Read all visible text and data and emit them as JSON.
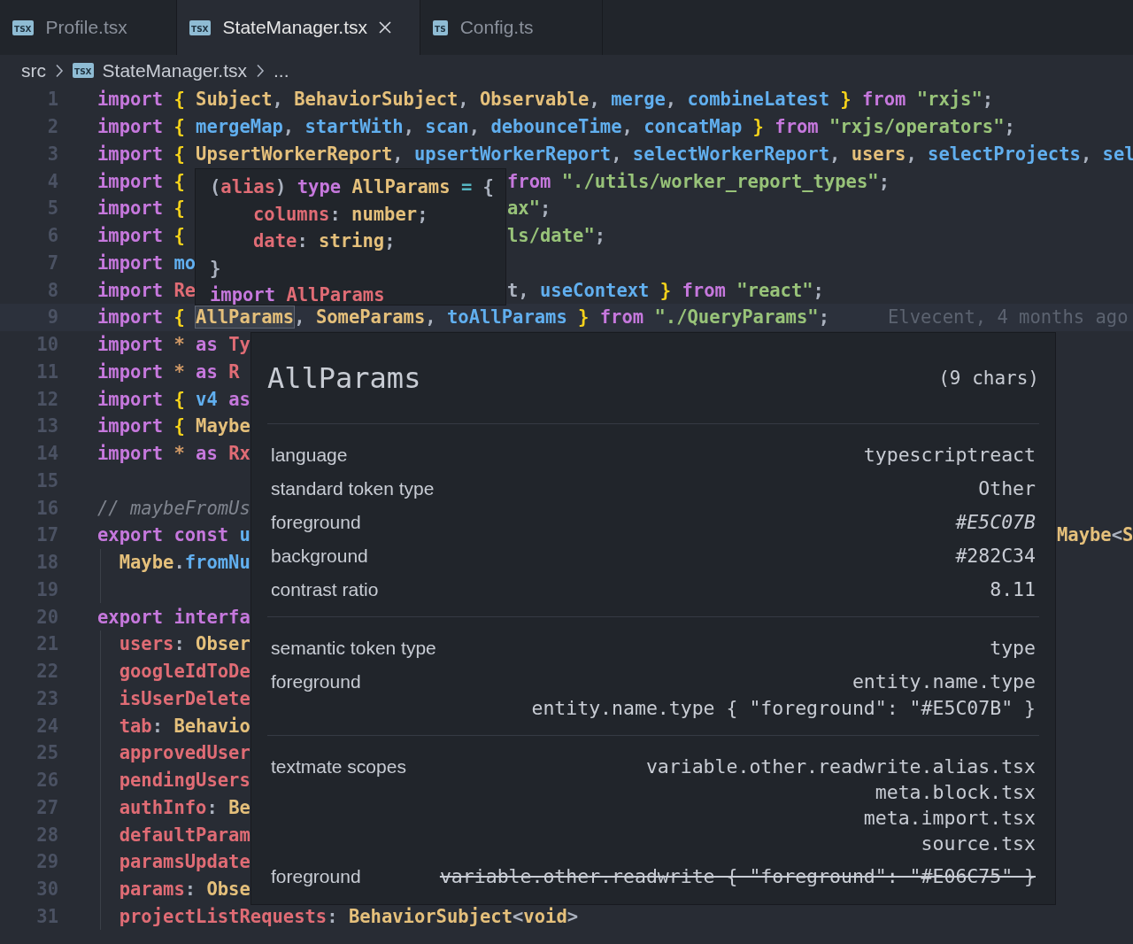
{
  "tabs": [
    {
      "badge": "TSX",
      "label": "Profile.tsx",
      "selected": false
    },
    {
      "badge": "TSX",
      "label": "StateManager.tsx",
      "selected": true
    },
    {
      "badge": "TS",
      "label": "Config.ts",
      "selected": false
    }
  ],
  "breadcrumb": [
    {
      "text": "src"
    },
    {
      "badge": "TSX",
      "text": "StateManager.tsx"
    },
    {
      "text": "..."
    }
  ],
  "lines": [
    {
      "num": "1",
      "current": false,
      "indented": false,
      "code": [
        {
          "kind": "kw",
          "text": "import "
        },
        {
          "kind": "br",
          "text": "{ "
        },
        {
          "kind": "ty",
          "text": "Subject"
        },
        {
          "kind": "pl",
          "text": ", "
        },
        {
          "kind": "ty",
          "text": "BehaviorSubject"
        },
        {
          "kind": "pl",
          "text": ", "
        },
        {
          "kind": "ty",
          "text": "Observable"
        },
        {
          "kind": "pl",
          "text": ", "
        },
        {
          "kind": "fn",
          "text": "merge"
        },
        {
          "kind": "pl",
          "text": ", "
        },
        {
          "kind": "fn",
          "text": "combineLatest"
        },
        {
          "kind": "br",
          "text": " }"
        },
        {
          "kind": "kw",
          "text": " from "
        },
        {
          "kind": "str",
          "text": "\"rxjs\""
        },
        {
          "kind": "pl",
          "text": ";"
        }
      ]
    },
    {
      "num": "2",
      "current": false,
      "indented": false,
      "code": [
        {
          "kind": "kw",
          "text": "import "
        },
        {
          "kind": "br",
          "text": "{ "
        },
        {
          "kind": "fn",
          "text": "mergeMap"
        },
        {
          "kind": "pl",
          "text": ", "
        },
        {
          "kind": "fn",
          "text": "startWith"
        },
        {
          "kind": "pl",
          "text": ", "
        },
        {
          "kind": "fn",
          "text": "scan"
        },
        {
          "kind": "pl",
          "text": ", "
        },
        {
          "kind": "fn",
          "text": "debounceTime"
        },
        {
          "kind": "pl",
          "text": ", "
        },
        {
          "kind": "fn",
          "text": "concatMap"
        },
        {
          "kind": "br",
          "text": " }"
        },
        {
          "kind": "kw",
          "text": " from "
        },
        {
          "kind": "str",
          "text": "\"rxjs/operators\""
        },
        {
          "kind": "pl",
          "text": ";"
        }
      ]
    },
    {
      "num": "3",
      "current": false,
      "indented": false,
      "code": [
        {
          "kind": "kw",
          "text": "import "
        },
        {
          "kind": "br",
          "text": "{ "
        },
        {
          "kind": "ty",
          "text": "UpsertWorkerReport"
        },
        {
          "kind": "pl",
          "text": ", "
        },
        {
          "kind": "fn",
          "text": "upsertWorkerReport"
        },
        {
          "kind": "pl",
          "text": ", "
        },
        {
          "kind": "fn",
          "text": "selectWorkerReport"
        },
        {
          "kind": "pl",
          "text": ", "
        },
        {
          "kind": "ty",
          "text": "users"
        },
        {
          "kind": "pl",
          "text": ", "
        },
        {
          "kind": "fn",
          "text": "selectProjects"
        },
        {
          "kind": "pl",
          "text": ", "
        },
        {
          "kind": "fn",
          "text": "sel"
        }
      ]
    },
    {
      "num": "4",
      "current": false,
      "indented": false,
      "code": [
        {
          "kind": "kw",
          "text": "import "
        },
        {
          "kind": "br",
          "text": "{"
        }
      ],
      "tail": [
        {
          "kind": "kw",
          "text": "from "
        },
        {
          "kind": "str",
          "text": "\"./utils/worker_report_types\""
        },
        {
          "kind": "pl",
          "text": ";"
        }
      ]
    },
    {
      "num": "5",
      "current": false,
      "indented": false,
      "code": [
        {
          "kind": "kw",
          "text": "import "
        },
        {
          "kind": "br",
          "text": "{"
        }
      ],
      "tail": [
        {
          "kind": "str",
          "text": "ax\""
        },
        {
          "kind": "pl",
          "text": ";"
        }
      ]
    },
    {
      "num": "6",
      "current": false,
      "indented": false,
      "code": [
        {
          "kind": "kw",
          "text": "import "
        },
        {
          "kind": "br",
          "text": "{"
        }
      ],
      "tail": [
        {
          "kind": "str",
          "text": "ls/date\""
        },
        {
          "kind": "pl",
          "text": ";"
        }
      ]
    },
    {
      "num": "7",
      "current": false,
      "indented": false,
      "code": [
        {
          "kind": "kw",
          "text": "import "
        },
        {
          "kind": "fn",
          "text": "mo"
        }
      ]
    },
    {
      "num": "8",
      "current": false,
      "indented": false,
      "code": [
        {
          "kind": "kw",
          "text": "import "
        },
        {
          "kind": "var",
          "text": "Re"
        }
      ],
      "tail": [
        {
          "kind": "pl",
          "text": "t, "
        },
        {
          "kind": "fn",
          "text": "useContext"
        },
        {
          "kind": "br",
          "text": " }"
        },
        {
          "kind": "kw",
          "text": " from "
        },
        {
          "kind": "str",
          "text": "\"react\""
        },
        {
          "kind": "pl",
          "text": ";"
        }
      ]
    },
    {
      "num": "9",
      "current": true,
      "indented": false,
      "code": [
        {
          "kind": "kw",
          "text": "import "
        },
        {
          "kind": "br",
          "text": "{ "
        },
        {
          "kind": "match",
          "text": "AllParams"
        },
        {
          "kind": "pl",
          "text": ", "
        },
        {
          "kind": "ty",
          "text": "SomeParams"
        },
        {
          "kind": "pl",
          "text": ", "
        },
        {
          "kind": "fn",
          "text": "toAllParams"
        },
        {
          "kind": "br",
          "text": " }"
        },
        {
          "kind": "kw",
          "text": " from "
        },
        {
          "kind": "str",
          "text": "\"./QueryParams\""
        },
        {
          "kind": "pl",
          "text": ";"
        }
      ],
      "blame": "Elvecent, 4 months ago"
    },
    {
      "num": "10",
      "current": false,
      "indented": false,
      "code": [
        {
          "kind": "kw",
          "text": "import "
        },
        {
          "kind": "op",
          "text": "* "
        },
        {
          "kind": "kw",
          "text": "as "
        },
        {
          "kind": "var",
          "text": "Ty"
        }
      ]
    },
    {
      "num": "11",
      "current": false,
      "indented": false,
      "code": [
        {
          "kind": "kw",
          "text": "import "
        },
        {
          "kind": "op",
          "text": "* "
        },
        {
          "kind": "kw",
          "text": "as "
        },
        {
          "kind": "var",
          "text": "R"
        }
      ]
    },
    {
      "num": "12",
      "current": false,
      "indented": false,
      "code": [
        {
          "kind": "kw",
          "text": "import "
        },
        {
          "kind": "br",
          "text": "{ "
        },
        {
          "kind": "fn",
          "text": "v4 "
        },
        {
          "kind": "kw",
          "text": "as"
        }
      ]
    },
    {
      "num": "13",
      "current": false,
      "indented": false,
      "code": [
        {
          "kind": "kw",
          "text": "import "
        },
        {
          "kind": "br",
          "text": "{ "
        },
        {
          "kind": "ty",
          "text": "Maybe"
        }
      ]
    },
    {
      "num": "14",
      "current": false,
      "indented": false,
      "code": [
        {
          "kind": "kw",
          "text": "import "
        },
        {
          "kind": "op",
          "text": "* "
        },
        {
          "kind": "kw",
          "text": "as "
        },
        {
          "kind": "var",
          "text": "Rx"
        }
      ]
    },
    {
      "num": "15",
      "current": false,
      "indented": false
    },
    {
      "num": "16",
      "current": false,
      "indented": false,
      "code": [
        {
          "kind": "cm",
          "text": "// maybeFromUs"
        }
      ]
    },
    {
      "num": "17",
      "current": false,
      "indented": false,
      "code": [
        {
          "kind": "kw",
          "text": "export const "
        },
        {
          "kind": "fn",
          "text": "u"
        }
      ],
      "tail": [
        {
          "kind": "ty",
          "text": "Maybe"
        },
        {
          "kind": "pl",
          "text": "<"
        },
        {
          "kind": "ty",
          "text": "S"
        }
      ]
    },
    {
      "num": "18",
      "current": false,
      "indented": true,
      "code": [
        {
          "kind": "ty",
          "text": "Maybe"
        },
        {
          "kind": "pl",
          "text": "."
        },
        {
          "kind": "fn",
          "text": "fromNu"
        }
      ]
    },
    {
      "num": "19",
      "current": false,
      "indented": true
    },
    {
      "num": "20",
      "current": false,
      "indented": false,
      "code": [
        {
          "kind": "kw",
          "text": "export interfa"
        }
      ]
    },
    {
      "num": "21",
      "current": false,
      "indented": true,
      "code": [
        {
          "kind": "var",
          "text": "users"
        },
        {
          "kind": "pl",
          "text": ": "
        },
        {
          "kind": "ty",
          "text": "Obser"
        }
      ]
    },
    {
      "num": "22",
      "current": false,
      "indented": true,
      "code": [
        {
          "kind": "var",
          "text": "googleIdToDe"
        }
      ]
    },
    {
      "num": "23",
      "current": false,
      "indented": true,
      "code": [
        {
          "kind": "var",
          "text": "isUserDelete"
        }
      ]
    },
    {
      "num": "24",
      "current": false,
      "indented": true,
      "code": [
        {
          "kind": "var",
          "text": "tab"
        },
        {
          "kind": "pl",
          "text": ": "
        },
        {
          "kind": "ty",
          "text": "Behavio"
        }
      ]
    },
    {
      "num": "25",
      "current": false,
      "indented": true,
      "code": [
        {
          "kind": "var",
          "text": "approvedUser"
        }
      ]
    },
    {
      "num": "26",
      "current": false,
      "indented": true,
      "code": [
        {
          "kind": "var",
          "text": "pendingUsers"
        }
      ]
    },
    {
      "num": "27",
      "current": false,
      "indented": true,
      "code": [
        {
          "kind": "var",
          "text": "authInfo"
        },
        {
          "kind": "pl",
          "text": ": "
        },
        {
          "kind": "ty",
          "text": "Be"
        }
      ]
    },
    {
      "num": "28",
      "current": false,
      "indented": true,
      "code": [
        {
          "kind": "var",
          "text": "defaultParam"
        }
      ]
    },
    {
      "num": "29",
      "current": false,
      "indented": true,
      "code": [
        {
          "kind": "var",
          "text": "paramsUpdate"
        }
      ]
    },
    {
      "num": "30",
      "current": false,
      "indented": true,
      "code": [
        {
          "kind": "var",
          "text": "params"
        },
        {
          "kind": "pl",
          "text": ": "
        },
        {
          "kind": "ty",
          "text": "Obse"
        }
      ]
    },
    {
      "num": "31",
      "current": false,
      "indented": true,
      "code": [
        {
          "kind": "var",
          "text": "projectListRequests"
        },
        {
          "kind": "pl",
          "text": ": "
        },
        {
          "kind": "ty",
          "text": "BehaviorSubject"
        },
        {
          "kind": "pl",
          "text": "<"
        },
        {
          "kind": "ty",
          "text": "void"
        },
        {
          "kind": "pl",
          "text": ">"
        }
      ]
    }
  ],
  "type_hover": {
    "lines": [
      {
        "indented": false,
        "code": [
          {
            "kind": "pl",
            "text": "("
          },
          {
            "kind": "var",
            "text": "alias"
          },
          {
            "kind": "pl",
            "text": ") "
          },
          {
            "kind": "kw",
            "text": "type "
          },
          {
            "kind": "ty",
            "text": "AllParams"
          },
          {
            "kind": "cy",
            "text": " = "
          },
          {
            "kind": "pl",
            "text": "{"
          }
        ]
      },
      {
        "indented": true,
        "code": [
          {
            "kind": "var",
            "text": "columns"
          },
          {
            "kind": "pl",
            "text": ": "
          },
          {
            "kind": "ty",
            "text": "number"
          },
          {
            "kind": "pl",
            "text": ";"
          }
        ]
      },
      {
        "indented": true,
        "code": [
          {
            "kind": "var",
            "text": "date"
          },
          {
            "kind": "pl",
            "text": ": "
          },
          {
            "kind": "ty",
            "text": "string"
          },
          {
            "kind": "pl",
            "text": ";"
          }
        ]
      },
      {
        "indented": false,
        "code": [
          {
            "kind": "pl",
            "text": "}"
          }
        ]
      },
      {
        "indented": false,
        "code": [
          {
            "kind": "kw",
            "text": "import "
          },
          {
            "kind": "var",
            "text": "AllParams"
          }
        ]
      }
    ]
  },
  "inspector": {
    "title": "AllParams",
    "length": "(9 chars)",
    "sections": [
      {
        "rows": [
          {
            "kind": "text",
            "label": "language",
            "values": [
              "typescriptreact"
            ]
          },
          {
            "kind": "text",
            "label": "standard token type",
            "values": [
              "Other"
            ]
          },
          {
            "kind": "color",
            "label": "foreground",
            "values": [
              "#E5C07B"
            ]
          },
          {
            "kind": "text",
            "label": "background",
            "values": [
              "#282C34"
            ]
          },
          {
            "kind": "text",
            "label": "contrast ratio",
            "values": [
              "8.11"
            ]
          }
        ]
      },
      {
        "rows": [
          {
            "kind": "text",
            "label": "semantic token type",
            "values": [
              "type"
            ]
          },
          {
            "kind": "text",
            "label": "foreground",
            "values": [
              "entity.name.type",
              "entity.name.type { \"foreground\": \"#E5C07B\" }"
            ]
          }
        ]
      },
      {
        "rows": [
          {
            "kind": "scopes",
            "label": "textmate scopes",
            "values": [
              "variable.other.readwrite.alias.tsx",
              "meta.block.tsx",
              "meta.import.tsx",
              "source.tsx"
            ]
          },
          {
            "kind": "overridden",
            "label": "foreground",
            "values": [
              "variable.other.readwrite { \"foreground\": \"#E06C75\" }"
            ]
          }
        ]
      }
    ]
  }
}
